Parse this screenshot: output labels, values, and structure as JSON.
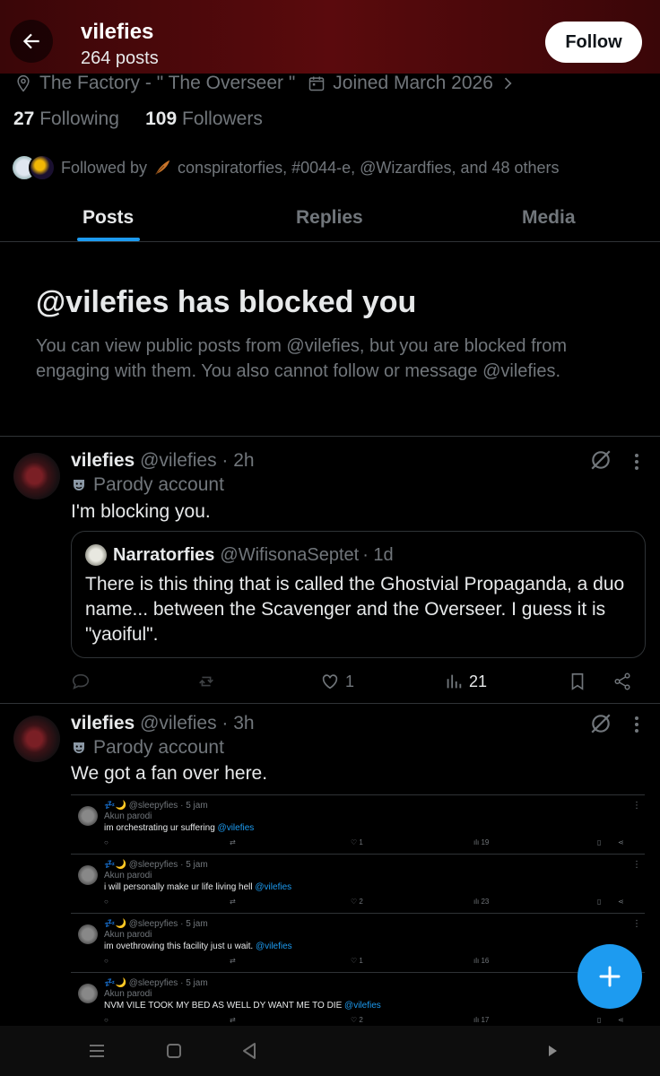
{
  "header": {
    "name": "vilefies",
    "post_count": "264 posts",
    "follow_label": "Follow"
  },
  "profile": {
    "location": "The Factory - \" The Overseer \"",
    "joined": "Joined March 2026",
    "following_count": "27",
    "following_label": "Following",
    "followers_count": "109",
    "followers_label": "Followers",
    "followed_by_prefix": "Followed by",
    "followed_by_names": "conspiratorfies, #0044-e, @Wizardfies, and 48 others"
  },
  "tabs": [
    {
      "label": "Posts"
    },
    {
      "label": "Replies"
    },
    {
      "label": "Media"
    }
  ],
  "blocked": {
    "title": "@vilefies has blocked you",
    "description": "You can view public posts from @vilefies, but you are blocked from engaging with them. You also cannot follow or message @vilefies."
  },
  "posts": [
    {
      "name": "vilefies",
      "handle": "@vilefies",
      "time": "· 2h",
      "badge": "Parody account",
      "text": "I'm blocking you.",
      "likes": "1",
      "views": "21",
      "quote": {
        "name": "Narratorfies",
        "handle": "@WifisonaSeptet",
        "time": "· 1d",
        "text": "There is this thing that is called the Ghostvial Propaganda, a duo name... between the Scavenger and the Overseer. I guess it is \"yaoiful\"."
      }
    },
    {
      "name": "vilefies",
      "handle": "@vilefies",
      "time": "· 3h",
      "badge": "Parody account",
      "text": "We got a fan over here."
    }
  ],
  "embedded": {
    "items": [
      {
        "name": "@sleepyfies · 5 jam",
        "badge": "Akun parodi",
        "text": "im orchestrating ur suffering",
        "mention": "@vilefies",
        "likes": "1",
        "views": "19"
      },
      {
        "name": "@sleepyfies · 5 jam",
        "badge": "Akun parodi",
        "text": "i will personally make ur life living hell",
        "mention": "@vilefies",
        "likes": "2",
        "views": "23"
      },
      {
        "name": "@sleepyfies · 5 jam",
        "badge": "Akun parodi",
        "text": "im ovethrowing this facility just u wait.",
        "mention": "@vilefies",
        "likes": "1",
        "views": "16"
      },
      {
        "name": "@sleepyfies · 5 jam",
        "badge": "Akun parodi",
        "text": "NVM VILE TOOK MY BED AS WELL DY WANT ME TO DIE",
        "mention": "@vilefies",
        "likes": "2",
        "views": "17"
      }
    ]
  },
  "colors": {
    "accent": "#1d9bf0",
    "header_bg": "#5a0a0d",
    "muted": "#71767b"
  }
}
